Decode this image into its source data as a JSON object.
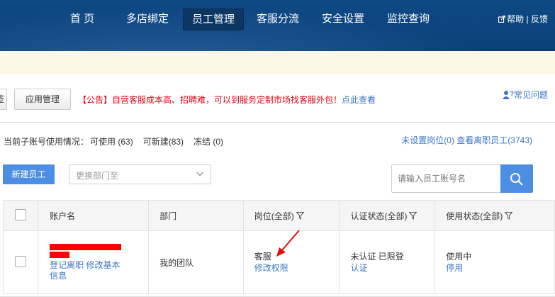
{
  "nav": {
    "items": [
      "首 页",
      "多店绑定",
      "员工管理",
      "客服分流",
      "安全设置",
      "监控查询"
    ],
    "active": "员工管理",
    "help": "帮助",
    "separator": " | ",
    "feedback": "反馈"
  },
  "tabs": {
    "partial_left": "签",
    "app_manage": "应用管理"
  },
  "announcement": {
    "prefix": "【公告】自营客服成本高、招聘难，可以到服务定制市场找客服外包！",
    "link": "点此查看"
  },
  "faq": "常见问题",
  "usage": {
    "label": "当前子账号使用情况：",
    "available": "可使用 (63)",
    "creatable": "可新建(83)",
    "frozen": "冻结 (0)"
  },
  "links": {
    "unset_post": "未设置岗位(0)",
    "view_resigned": "查看离职员工(3743)"
  },
  "toolbar": {
    "new_employee": "新建员工",
    "dept_placeholder": "更换部门至",
    "search_placeholder": "请输入员工账号名"
  },
  "table": {
    "headers": [
      "账户名",
      "部门",
      "岗位(全部)",
      "认证状态(全部)",
      "使用状态(全部)"
    ],
    "rows": [
      {
        "actions": "登记离职 修改基本信息",
        "dept": "我的团队",
        "post": "客服",
        "post_action": "修改权限",
        "auth": "未认证 已限登",
        "auth_action": "认证",
        "status": "使用中",
        "status_action": "停用"
      }
    ]
  },
  "colors": {
    "header": "#0f4a86",
    "accent": "#4b8ee4",
    "link": "#3a76c4",
    "notice": "#e60012",
    "redaction": "#ff0000",
    "annotation_arrow": "#e01010"
  }
}
